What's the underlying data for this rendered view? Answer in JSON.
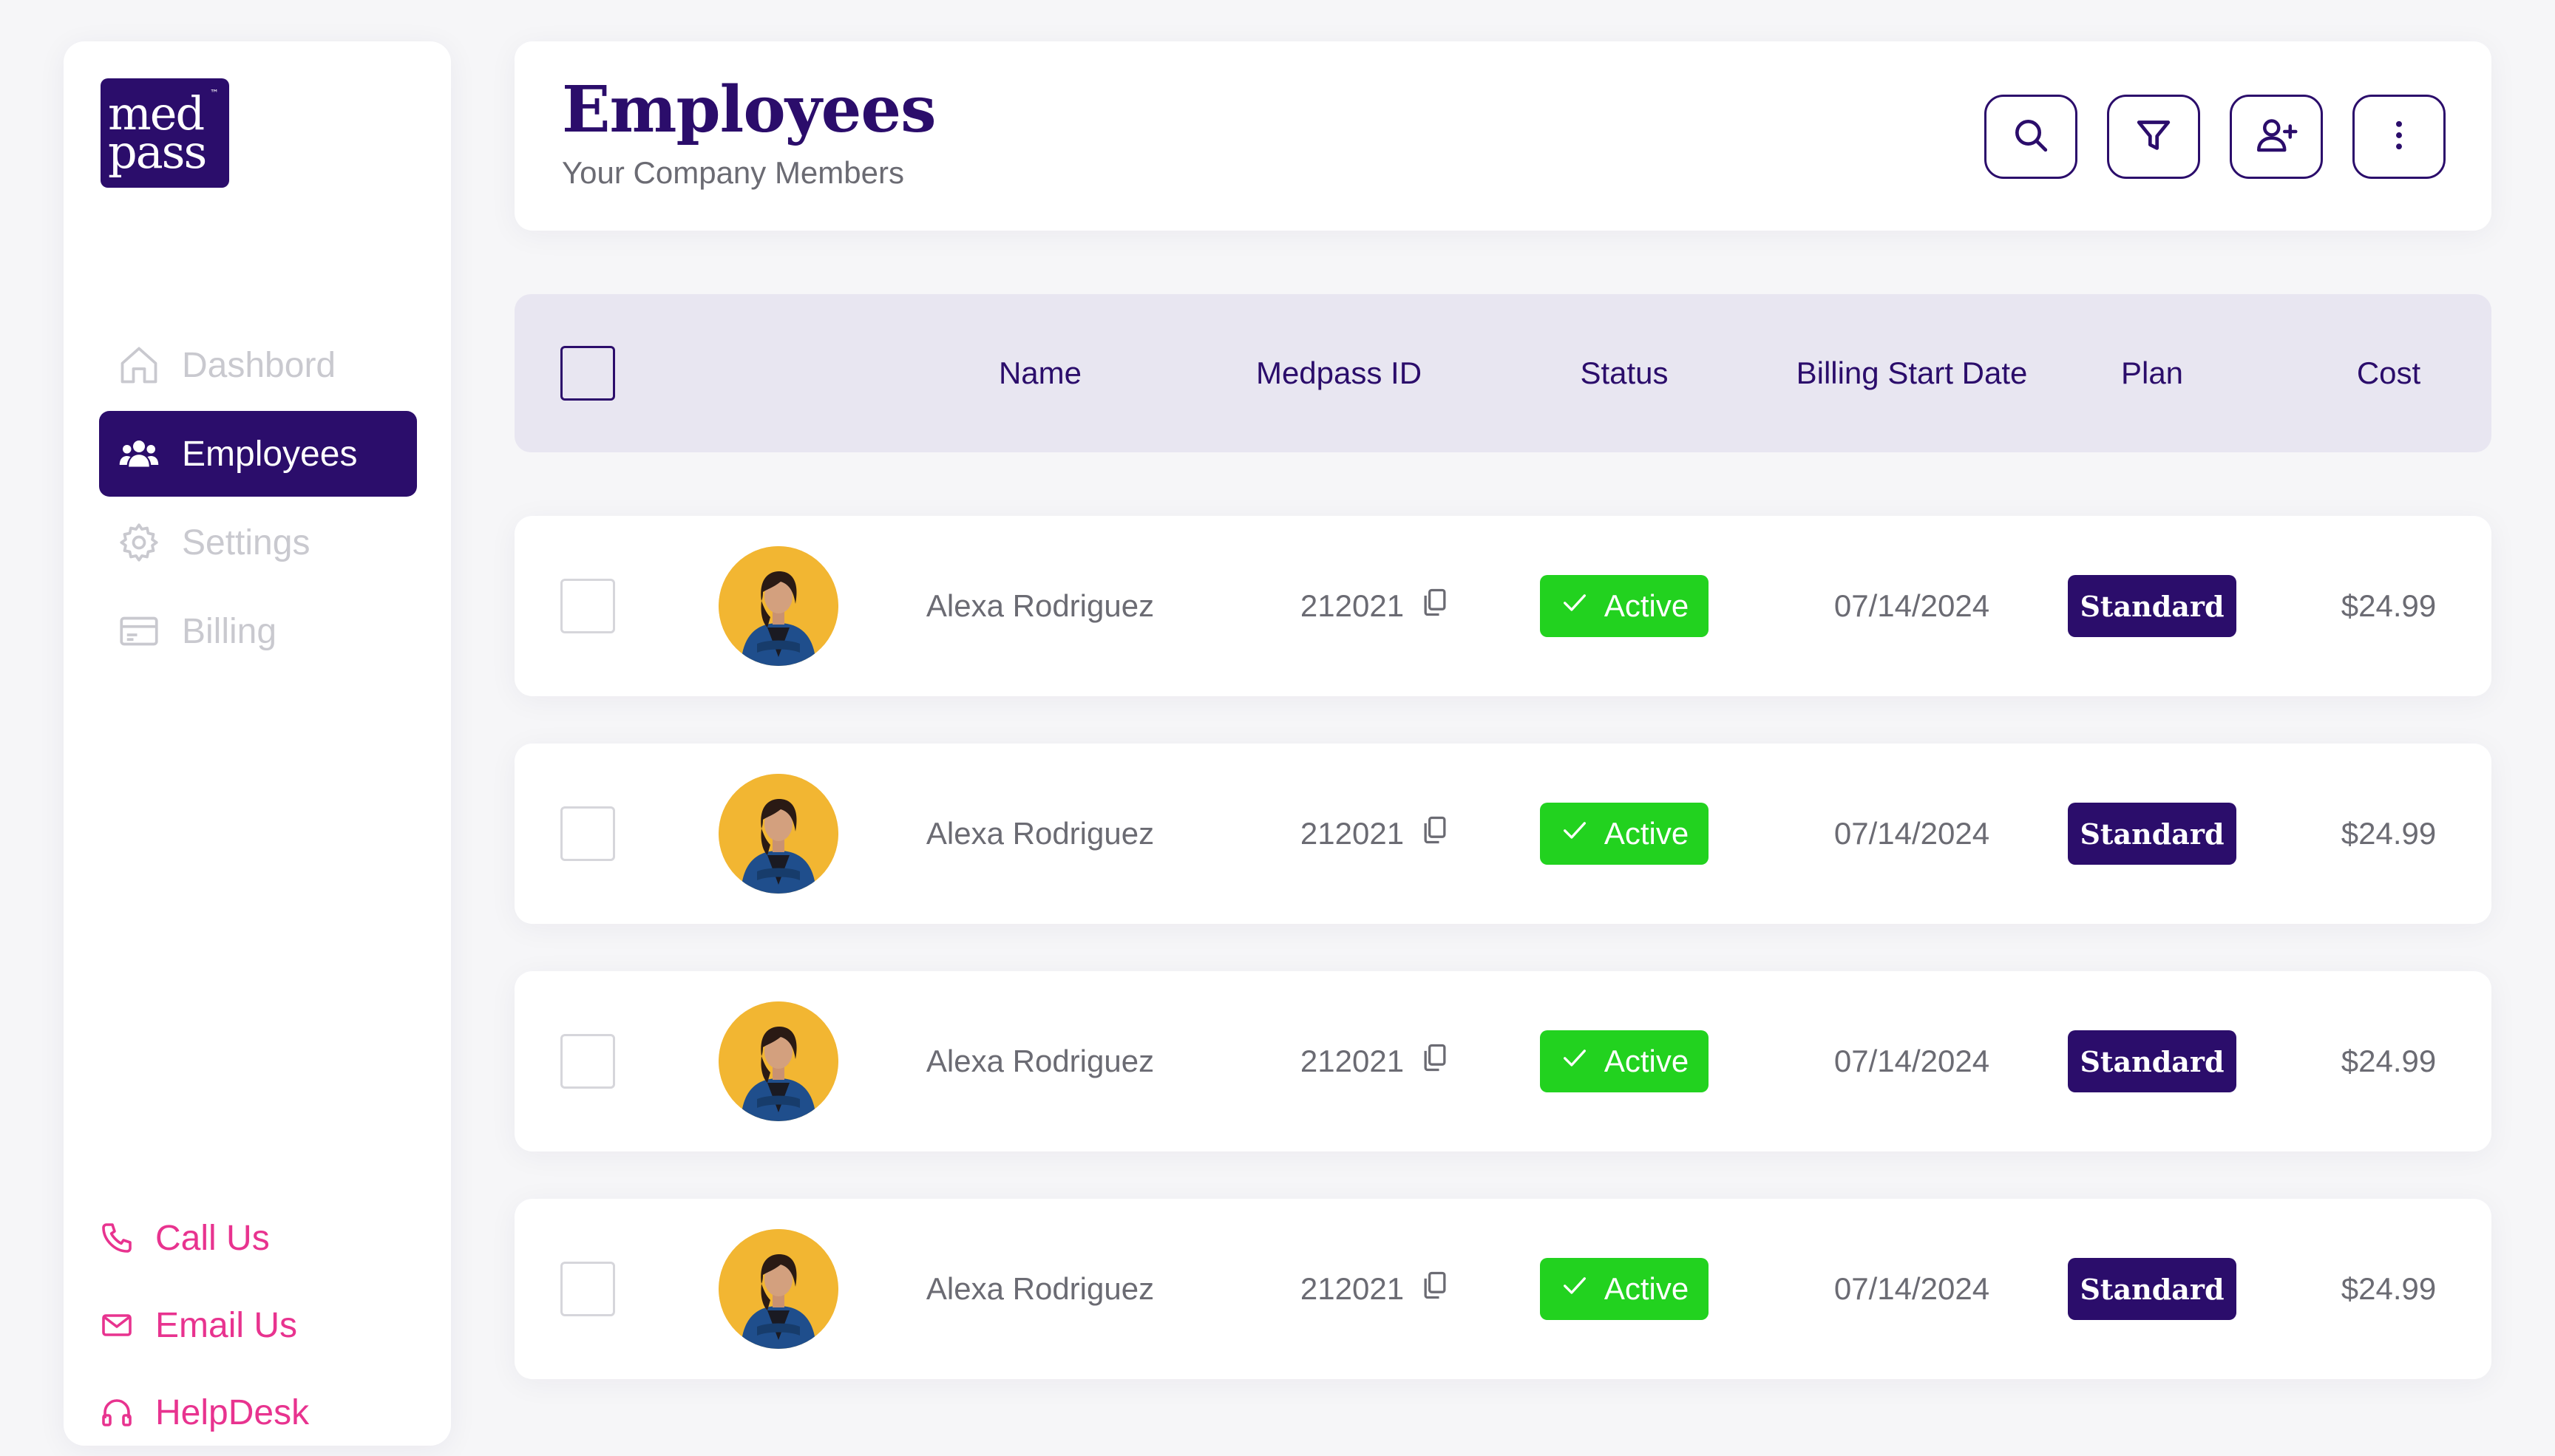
{
  "brand": {
    "line1": "med",
    "line2": "pass",
    "tm": "™"
  },
  "sidebar": {
    "items": [
      {
        "label": "Dashbord",
        "icon": "home-icon",
        "active": false
      },
      {
        "label": "Employees",
        "icon": "people-icon",
        "active": true
      },
      {
        "label": "Settings",
        "icon": "gear-icon",
        "active": false
      },
      {
        "label": "Billing",
        "icon": "credit-card-icon",
        "active": false
      }
    ],
    "contacts": [
      {
        "label": "Call Us",
        "icon": "phone-icon"
      },
      {
        "label": "Email Us",
        "icon": "mail-icon"
      },
      {
        "label": "HelpDesk",
        "icon": "headset-icon"
      }
    ]
  },
  "header": {
    "title": "Employees",
    "subtitle": "Your Company Members",
    "actions": [
      "search-icon",
      "filter-icon",
      "add-user-icon",
      "more-vertical-icon"
    ]
  },
  "table": {
    "columns": [
      "Name",
      "Medpass ID",
      "Status",
      "Billing Start Date",
      "Plan",
      "Cost"
    ],
    "rows": [
      {
        "name": "Alexa Rodriguez",
        "medpass_id": "212021",
        "status": "Active",
        "billing_start": "07/14/2024",
        "plan": "Standard",
        "cost": "$24.99"
      },
      {
        "name": "Alexa Rodriguez",
        "medpass_id": "212021",
        "status": "Active",
        "billing_start": "07/14/2024",
        "plan": "Standard",
        "cost": "$24.99"
      },
      {
        "name": "Alexa Rodriguez",
        "medpass_id": "212021",
        "status": "Active",
        "billing_start": "07/14/2024",
        "plan": "Standard",
        "cost": "$24.99"
      },
      {
        "name": "Alexa Rodriguez",
        "medpass_id": "212021",
        "status": "Active",
        "billing_start": "07/14/2024",
        "plan": "Standard",
        "cost": "$24.99"
      }
    ]
  },
  "colors": {
    "brand": "#2b0d6b",
    "accent_pink": "#e8338f",
    "active_green": "#22d21f",
    "header_row": "#e8e6f1"
  }
}
